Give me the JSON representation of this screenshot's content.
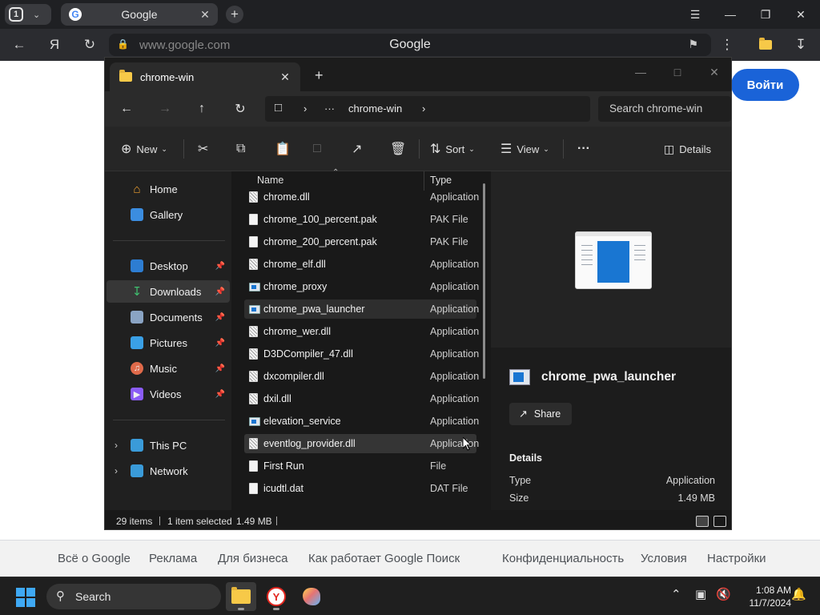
{
  "browser": {
    "tab_count": "1",
    "tab_title": "Google",
    "url": "www.google.com",
    "page_title": "Google"
  },
  "google": {
    "login_label": "Войти",
    "footer_links": [
      "Всё о Google",
      "Реклама",
      "Для бизнеса",
      "Как работает Google Поиск",
      "Конфиденциальность",
      "Условия",
      "Настройки"
    ]
  },
  "explorer": {
    "tab_title": "chrome-win",
    "breadcrumb_current": "chrome-win",
    "breadcrumb_more": "···",
    "search_placeholder": "Search chrome-win",
    "commands": {
      "new": "New",
      "sort": "Sort",
      "view": "View",
      "more": "···",
      "details": "Details"
    },
    "nav": {
      "home": "Home",
      "gallery": "Gallery",
      "desktop": "Desktop",
      "downloads": "Downloads",
      "documents": "Documents",
      "pictures": "Pictures",
      "music": "Music",
      "videos": "Videos",
      "this_pc": "This PC",
      "network": "Network"
    },
    "columns": {
      "name": "Name",
      "type": "Type"
    },
    "files": [
      {
        "name": "chrome.dll",
        "type": "Application",
        "icon": "dll"
      },
      {
        "name": "chrome_100_percent.pak",
        "type": "PAK File",
        "icon": "file"
      },
      {
        "name": "chrome_200_percent.pak",
        "type": "PAK File",
        "icon": "file"
      },
      {
        "name": "chrome_elf.dll",
        "type": "Application",
        "icon": "dll"
      },
      {
        "name": "chrome_proxy",
        "type": "Application",
        "icon": "exe"
      },
      {
        "name": "chrome_pwa_launcher",
        "type": "Application",
        "icon": "exe"
      },
      {
        "name": "chrome_wer.dll",
        "type": "Application",
        "icon": "dll"
      },
      {
        "name": "D3DCompiler_47.dll",
        "type": "Application",
        "icon": "dll"
      },
      {
        "name": "dxcompiler.dll",
        "type": "Application",
        "icon": "dll"
      },
      {
        "name": "dxil.dll",
        "type": "Application",
        "icon": "dll"
      },
      {
        "name": "elevation_service",
        "type": "Application",
        "icon": "exe"
      },
      {
        "name": "eventlog_provider.dll",
        "type": "Application",
        "icon": "dll"
      },
      {
        "name": "First Run",
        "type": "File",
        "icon": "file"
      },
      {
        "name": "icudtl.dat",
        "type": "DAT File",
        "icon": "file"
      }
    ],
    "details": {
      "file_name": "chrome_pwa_launcher",
      "share_label": "Share",
      "section_title": "Details",
      "type_label": "Type",
      "type_value": "Application",
      "size_label": "Size",
      "size_value": "1.49 MB"
    },
    "status": {
      "items": "29 items",
      "selected": "1 item selected",
      "size": "1.49 MB"
    }
  },
  "taskbar": {
    "search_placeholder": "Search",
    "time": "1:08 AM",
    "date": "11/7/2024"
  }
}
